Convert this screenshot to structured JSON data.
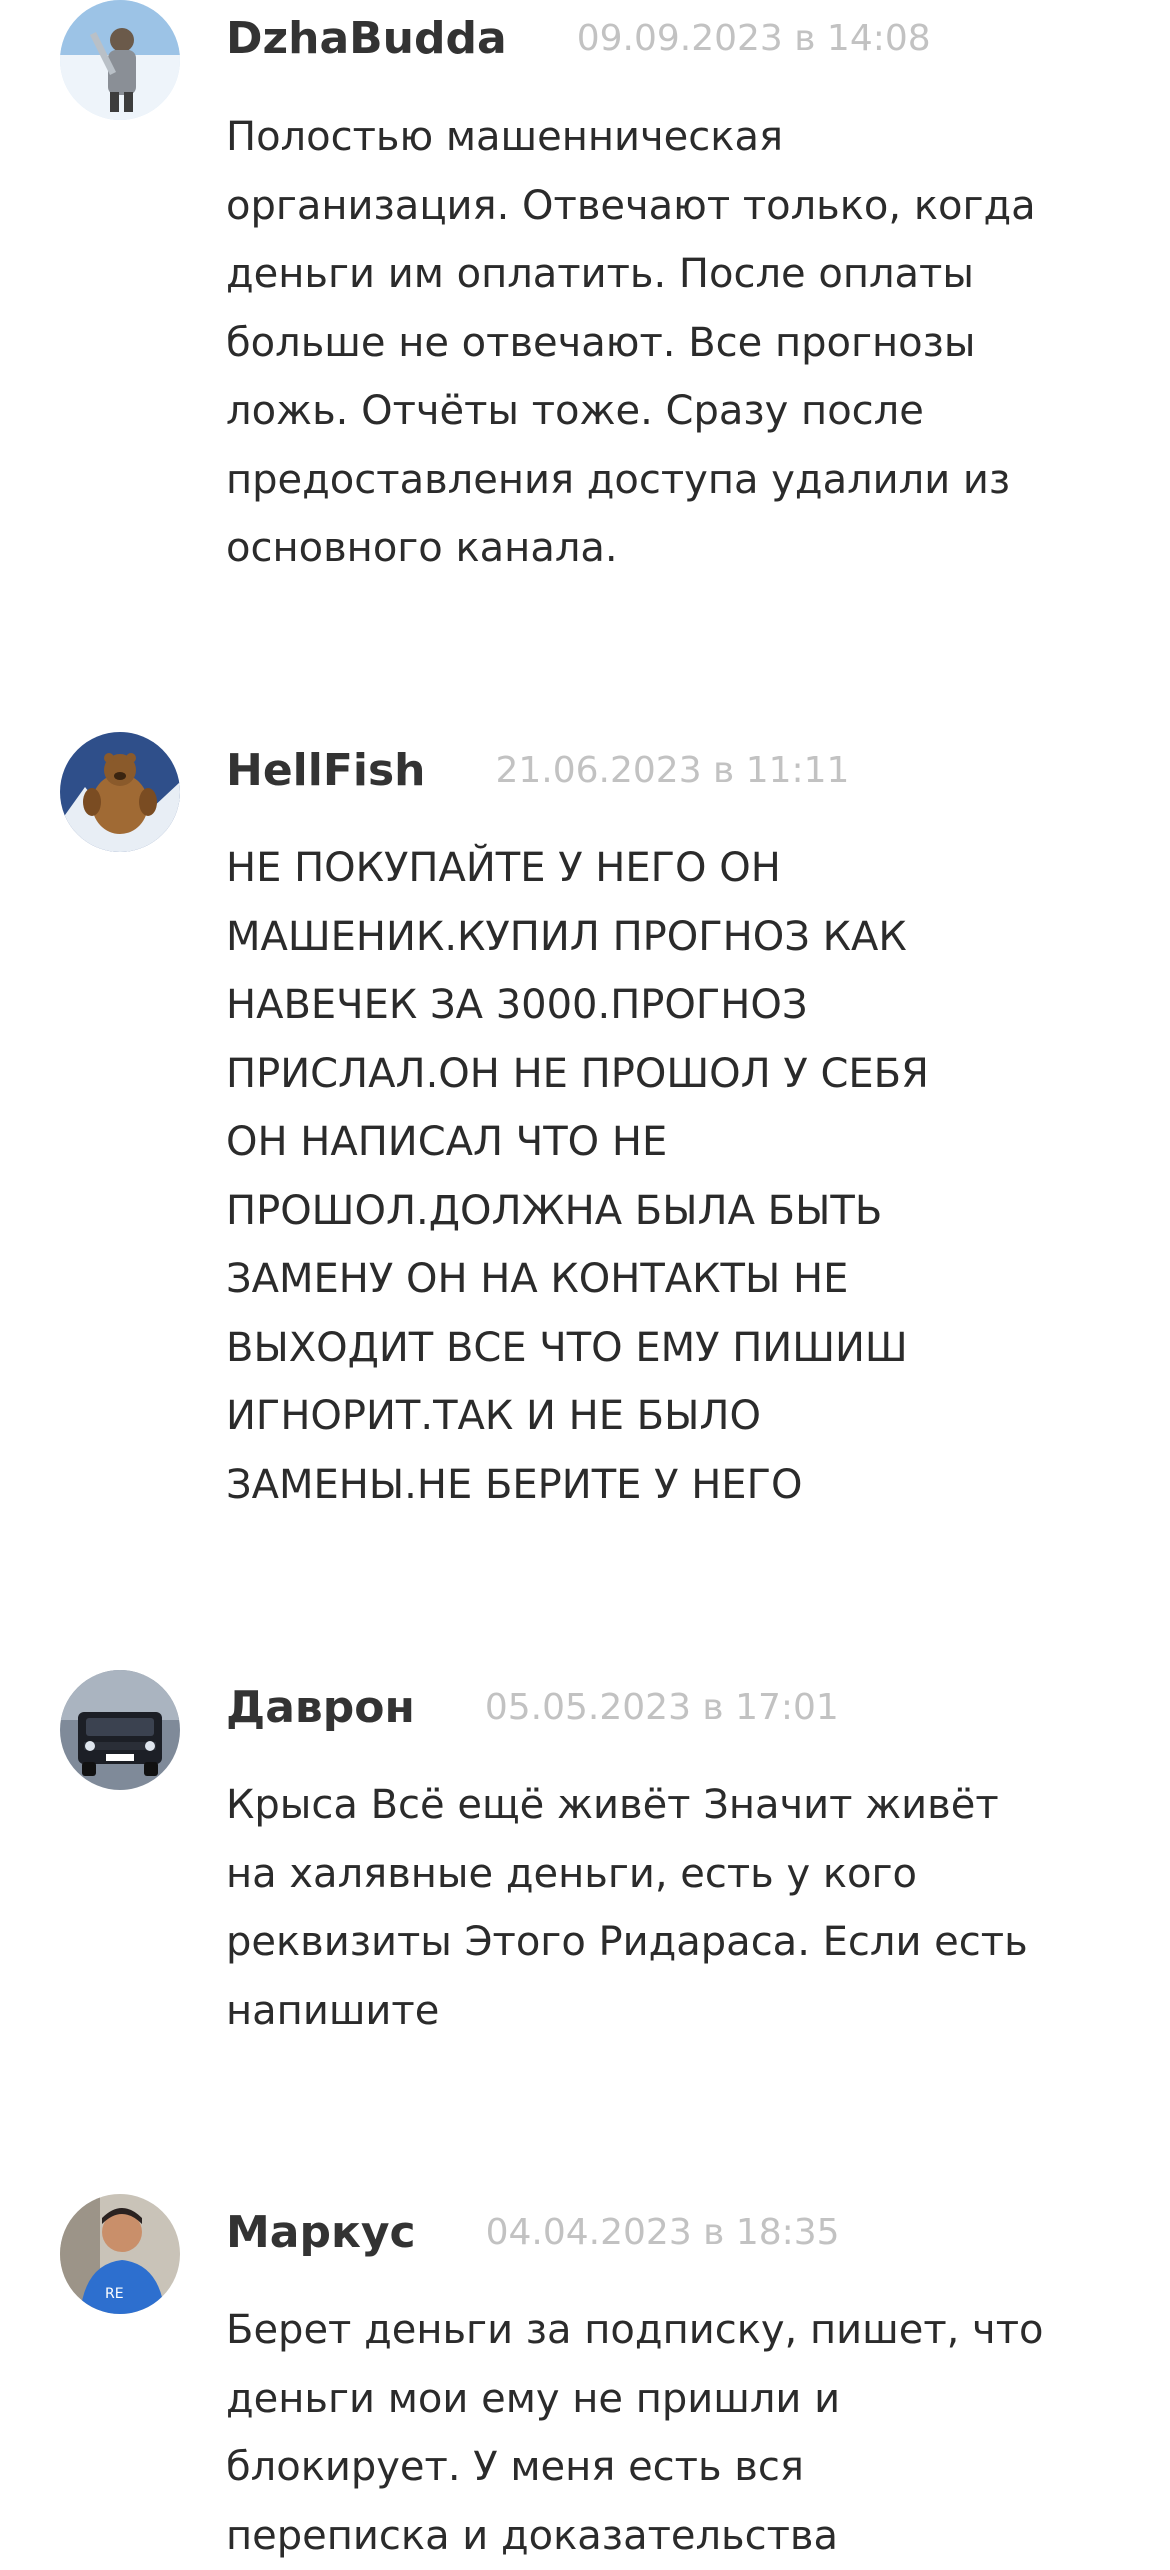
{
  "comments": [
    {
      "author": "DzhaBudda",
      "date": "09.09.2023 в 14:08",
      "text": "Полостью машенническая\nорганизация. Отвечают только, когда\nденьги им оплатить. После оплаты\nбольше не отвечают. Все прогнозы\nложь. Отчёты тоже. Сразу после\nпредоставления доступа удалили из\nосновного канала."
    },
    {
      "author": "HellFish",
      "date": "21.06.2023 в 11:11",
      "text": "НЕ ПОКУПАЙТЕ У НЕГО ОН\nМАШЕНИК.КУПИЛ ПРОГНОЗ КАК\nНАВЕЧЕК ЗА 3000.ПРОГНОЗ\nПРИСЛАЛ.ОН НЕ ПРОШОЛ У СЕБЯ\nОН НАПИСАЛ ЧТО НЕ\nПРОШОЛ.ДОЛЖНА БЫЛА БЫТЬ\nЗАМЕНУ ОН НА КОНТАКТЫ НЕ\nВЫХОДИТ ВСЕ ЧТО ЕМУ ПИШИШ\nИГНОРИТ.ТАК И НЕ БЫЛО\nЗАМЕНЫ.НЕ БЕРИТЕ У НЕГО"
    },
    {
      "author": "Даврон",
      "date": "05.05.2023 в 17:01",
      "text": "Крыса Всё ещё живёт Значит живёт\nна халявные деньги, есть у кого\nреквизиты Этого Ридараса. Если есть\nнапишите"
    },
    {
      "author": "Маркус",
      "date": "04.04.2023 в 18:35",
      "text": "Берет деньги за подписку, пишет, что\nденьги мои ему не пришли и\nблокирует. У меня есть вся\nпереписка и доказательства"
    }
  ]
}
